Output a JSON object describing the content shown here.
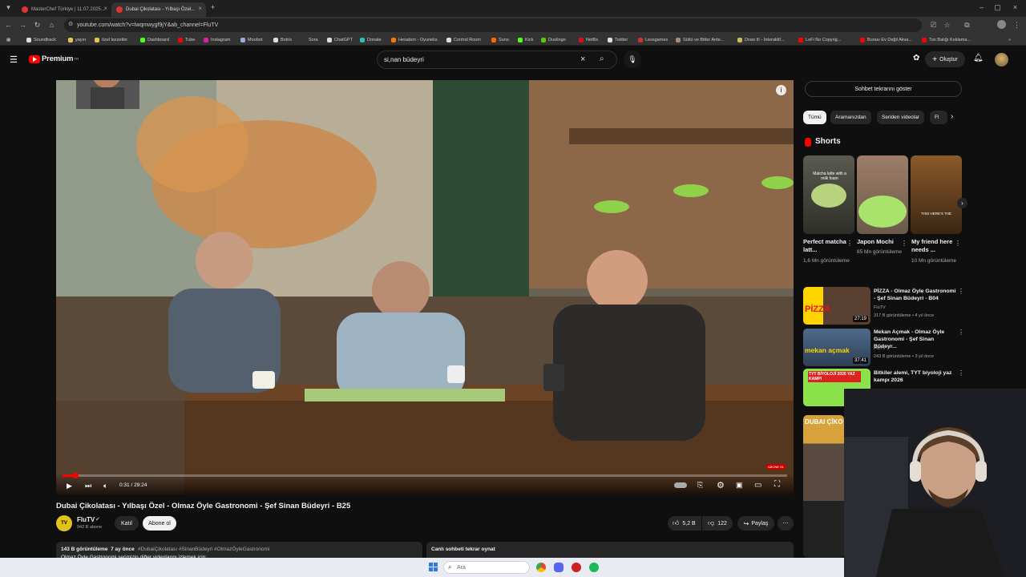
{
  "browser": {
    "tabs": [
      {
        "label": "MasterChef Türkiye | 11.07.2025..."
      },
      {
        "label": "Dubai Çikolatası - Yılbaşı Özel..."
      }
    ],
    "url": "youtube.com/watch?v=lwqmwygf9jY&ab_channel=FluTV",
    "bookmarks": [
      "Soundtrack",
      "yayın",
      "özel lezzetler",
      "Dashboard",
      "Tube",
      "Instagram",
      "Moobot",
      "Botrix",
      "Sora",
      "ChatGPT",
      "Donate",
      "Hesabım - Oyuneks",
      "Control Room",
      "Suno",
      "Kick",
      "Duolingo",
      "Netflix",
      "Twitter",
      "Lessgames",
      "Sütlü ve Bitter Ante...",
      "Draw It! - İnteraktif...",
      "LoFi No Copyrig...",
      "Burası Ev Değil Akva...",
      "Ton Balığı Koklama..."
    ]
  },
  "header": {
    "logo": "Premium",
    "logo_sup": "TR",
    "search_value": "si,nan büdeyri",
    "create_label": "Oluştur"
  },
  "player": {
    "time": "0:31 / 29:24",
    "progress_fraction": 0.018,
    "subscribe_badge": "ABONE OL"
  },
  "video": {
    "title": "Dubai Çikolatası - Yılbaşı Özel - Olmaz Öyle Gastronomi - Şef Sinan Büdeyri - B25",
    "channel": "FluTV",
    "subscribers": "942 B abone",
    "join_label": "Katıl",
    "subscribe_label": "Abone ol",
    "likes": "5,2 B",
    "dislikes": "122",
    "share_label": "Paylaş",
    "desc_stats": "143 B görüntüleme  7 ay önce",
    "desc_tags": "#DubaiÇikolatası #SinanBüdeyri #OlmazÖyleGastronomi",
    "desc_line2": "Olmaz Öyle Gastronomi serimizin diğer videolarını izlemek için:",
    "live_chat_replay": "Canlı sohbeti tekrar oynat"
  },
  "sidebar": {
    "chat_button": "Sohbet tekrarını göster",
    "chips": [
      "Tümü",
      "Aramanızdan",
      "Seriden videolar",
      "Fl"
    ],
    "shorts_heading": "Shorts",
    "shorts": [
      {
        "title": "Perfect matcha latt...",
        "views": "1,6 Mn görüntüleme",
        "overlay": "Matcha latte with a milk foam"
      },
      {
        "title": "Japon Mochi",
        "views": "85 Mn görüntüleme",
        "overlay": ""
      },
      {
        "title": "My friend here needs ...",
        "views": "10 Mn görüntüleme",
        "overlay": "THIS HERE'S THE"
      }
    ],
    "recommendations": [
      {
        "title": "PİZZA - Olmaz Öyle Gastronomi - Şef Sinan Büdeyri - B04",
        "channel": "FluTV",
        "meta": "317 B görüntüleme • 4 yıl önce",
        "duration": "27:19",
        "thumb_text": "PİZZA"
      },
      {
        "title": "Mekan Açmak - Olmaz Öyle Gastronomi - Şef Sinan Büdeyr...",
        "channel": "FluTV",
        "meta": "243 B görüntüleme • 3 yıl önce",
        "duration": "37:41",
        "thumb_text": "mekan açmak"
      },
      {
        "title": "Bitkiler alemi, TYT biyoloji yaz kampı 2026",
        "channel": "",
        "meta": "",
        "duration": "",
        "thumb_text": "TYT BİYOLOJİ 2026 YAZ KAMPI"
      },
      {
        "title": "",
        "channel": "",
        "meta": "",
        "duration": "",
        "thumb_text": "DUBAI ÇİKO"
      }
    ]
  },
  "taskbar": {
    "search_placeholder": "Ara"
  },
  "colors": {
    "youtube_red": "#ff0000",
    "bg": "#0f0f0f",
    "chip_bg": "#272727"
  }
}
